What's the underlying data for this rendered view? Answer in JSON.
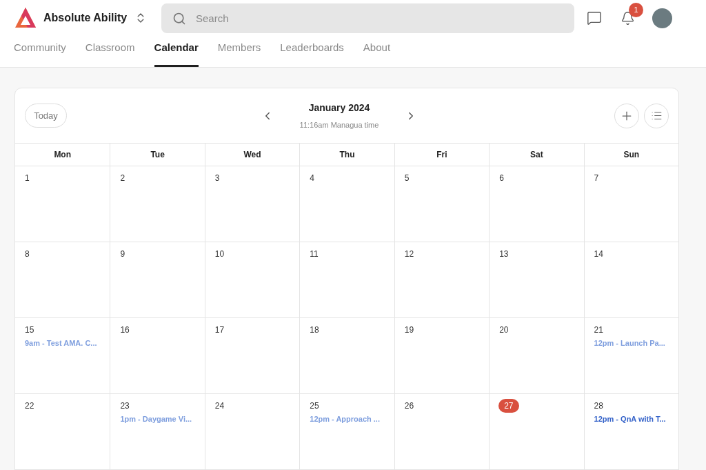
{
  "brand": {
    "name": "Absolute Ability"
  },
  "search": {
    "placeholder": "Search"
  },
  "notifications": {
    "count": "1"
  },
  "tabs": [
    {
      "label": "Community",
      "selected": false
    },
    {
      "label": "Classroom",
      "selected": false
    },
    {
      "label": "Calendar",
      "selected": true
    },
    {
      "label": "Members",
      "selected": false
    },
    {
      "label": "Leaderboards",
      "selected": false
    },
    {
      "label": "About",
      "selected": false
    }
  ],
  "calendar": {
    "today_button": "Today",
    "month": "January 2024",
    "local_time": "11:16am Managua time",
    "weekdays": [
      "Mon",
      "Tue",
      "Wed",
      "Thu",
      "Fri",
      "Sat",
      "Sun"
    ],
    "weeks": [
      [
        {
          "day": "1",
          "today": false
        },
        {
          "day": "2",
          "today": false
        },
        {
          "day": "3",
          "today": false
        },
        {
          "day": "4",
          "today": false
        },
        {
          "day": "5",
          "today": false
        },
        {
          "day": "6",
          "today": false
        },
        {
          "day": "7",
          "today": false
        }
      ],
      [
        {
          "day": "8",
          "today": false
        },
        {
          "day": "9",
          "today": false
        },
        {
          "day": "10",
          "today": false
        },
        {
          "day": "11",
          "today": false
        },
        {
          "day": "12",
          "today": false
        },
        {
          "day": "13",
          "today": false
        },
        {
          "day": "14",
          "today": false
        }
      ],
      [
        {
          "day": "15",
          "today": false,
          "events": [
            {
              "title": "9am - Test AMA. C...",
              "past": true
            }
          ]
        },
        {
          "day": "16",
          "today": false
        },
        {
          "day": "17",
          "today": false
        },
        {
          "day": "18",
          "today": false
        },
        {
          "day": "19",
          "today": false
        },
        {
          "day": "20",
          "today": false
        },
        {
          "day": "21",
          "today": false,
          "events": [
            {
              "title": "12pm - Launch Pa...",
              "past": true
            }
          ]
        }
      ],
      [
        {
          "day": "22",
          "today": false
        },
        {
          "day": "23",
          "today": false,
          "events": [
            {
              "title": "1pm - Daygame Vi...",
              "past": true
            }
          ]
        },
        {
          "day": "24",
          "today": false
        },
        {
          "day": "25",
          "today": false,
          "events": [
            {
              "title": "12pm - Approach ...",
              "past": true
            }
          ]
        },
        {
          "day": "26",
          "today": false
        },
        {
          "day": "27",
          "today": true
        },
        {
          "day": "28",
          "today": false,
          "events": [
            {
              "title": "12pm - QnA with T...",
              "past": false
            }
          ]
        }
      ]
    ]
  }
}
